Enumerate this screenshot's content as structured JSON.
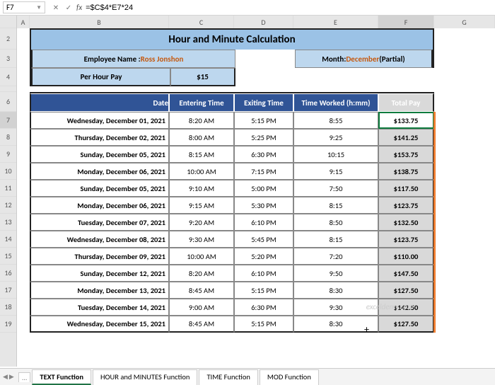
{
  "nameBox": "F7",
  "formula": "=$C$4*E7*24",
  "cols": [
    "A",
    "B",
    "C",
    "D",
    "E",
    "F",
    "G"
  ],
  "rows": [
    "2",
    "3",
    "4",
    "6",
    "7",
    "8",
    "9",
    "10",
    "11",
    "12",
    "13",
    "14",
    "15",
    "16",
    "17",
    "18",
    "19"
  ],
  "title": "Hour and Minute Calculation",
  "employeeLabel": "Employee Name :",
  "employeeName": " Ross Jonshon",
  "monthLabel": "Month: ",
  "monthValue": "December",
  "monthSuffix": " (Partial)",
  "perHourLabel": "Per Hour Pay",
  "perHourValue": "$15",
  "headers": {
    "date": "Date",
    "enter": "Entering Time",
    "exit": "Exiting Time",
    "worked": "Time Worked (h:mm)",
    "pay": "Total Pay"
  },
  "data": [
    {
      "date": "Wednesday, December 01, 2021",
      "enter": "8:20 AM",
      "exit": "5:15 PM",
      "worked": "8:55",
      "pay": "$133.75"
    },
    {
      "date": "Thursday, December 02, 2021",
      "enter": "8:00 AM",
      "exit": "5:25 PM",
      "worked": "9:25",
      "pay": "$141.25"
    },
    {
      "date": "Sunday, December 05, 2021",
      "enter": "8:15 AM",
      "exit": "6:30 PM",
      "worked": "10:15",
      "pay": "$153.75"
    },
    {
      "date": "Monday, December 06, 2021",
      "enter": "10:00 AM",
      "exit": "7:15 PM",
      "worked": "9:15",
      "pay": "$138.75"
    },
    {
      "date": "Sunday, December 05, 2021",
      "enter": "9:10 AM",
      "exit": "5:00 PM",
      "worked": "7:50",
      "pay": "$117.50"
    },
    {
      "date": "Monday, December 06, 2021",
      "enter": "9:15 AM",
      "exit": "5:30 PM",
      "worked": "8:15",
      "pay": "$123.75"
    },
    {
      "date": "Tuesday, December 07, 2021",
      "enter": "9:20 AM",
      "exit": "6:10 PM",
      "worked": "8:50",
      "pay": "$132.50"
    },
    {
      "date": "Wednesday, December 08, 2021",
      "enter": "9:30 AM",
      "exit": "5:45 PM",
      "worked": "8:15",
      "pay": "$123.75"
    },
    {
      "date": "Thursday, December 09, 2021",
      "enter": "10:00 AM",
      "exit": "5:20 PM",
      "worked": "7:20",
      "pay": "$110.00"
    },
    {
      "date": "Sunday, December 12, 2021",
      "enter": "8:20 AM",
      "exit": "6:10 PM",
      "worked": "9:50",
      "pay": "$147.50"
    },
    {
      "date": "Monday, December 13, 2021",
      "enter": "8:45 AM",
      "exit": "5:15 PM",
      "worked": "8:30",
      "pay": "$127.50"
    },
    {
      "date": "Tuesday, December 14, 2021",
      "enter": "9:00 AM",
      "exit": "6:30 PM",
      "worked": "9:30",
      "pay": "$142.50"
    },
    {
      "date": "Wednesday, December 15, 2021",
      "enter": "8:45 AM",
      "exit": "5:15 PM",
      "worked": "8:30",
      "pay": "$127.50"
    }
  ],
  "tabs": [
    "TEXT Function",
    "HOUR and MINUTES Function",
    "TIME Function",
    "MOD Function"
  ],
  "activeTab": 0,
  "watermark": "exceldemy.com"
}
